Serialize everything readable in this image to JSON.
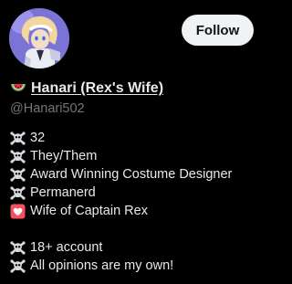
{
  "profile": {
    "avatar_alt": "avatar",
    "display_name": "Hanari (Rex's Wife)",
    "name_emoji": "watermelon-icon",
    "handle": "@Hanari502",
    "follow_label": "Follow"
  },
  "bio": {
    "lines": [
      {
        "icon": "skull-crossbones-icon",
        "text": "32"
      },
      {
        "icon": "skull-crossbones-icon",
        "text": "They/Them"
      },
      {
        "icon": "skull-crossbones-icon",
        "text": "Award Winning Costume Designer"
      },
      {
        "icon": "skull-crossbones-icon",
        "text": "Permanerd"
      },
      {
        "icon": "heart-icon",
        "text": "Wife of Captain Rex"
      },
      {
        "icon": "skull-crossbones-icon",
        "text": "18+ account"
      },
      {
        "icon": "skull-crossbones-icon",
        "text": "All opinions are my own!"
      }
    ]
  },
  "colors": {
    "background": "#000000",
    "primary_text": "#e7e9ea",
    "secondary_text": "#71767b",
    "follow_button_bg": "#eff3f4",
    "follow_button_text": "#0f1419",
    "heart": "#f4505f"
  }
}
